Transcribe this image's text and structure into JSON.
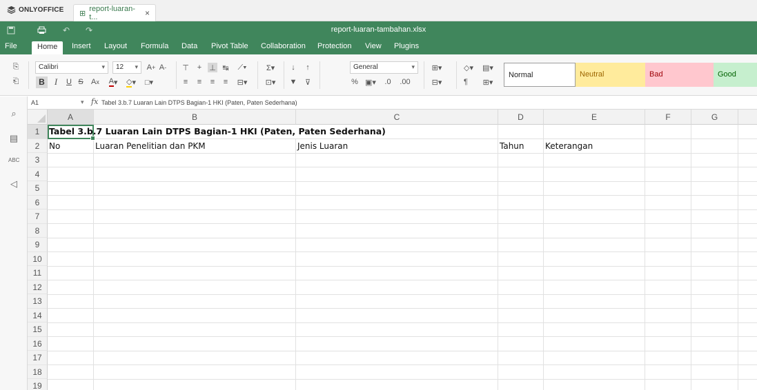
{
  "brand": {
    "name": "ONLYOFFICE"
  },
  "tab": {
    "title": "report-luaran-t...",
    "close": "×"
  },
  "window": {
    "filename": "report-luaran-tambahan.xlsx"
  },
  "menu": [
    "File",
    "Home",
    "Insert",
    "Layout",
    "Formula",
    "Data",
    "Pivot Table",
    "Collaboration",
    "Protection",
    "View",
    "Plugins"
  ],
  "active_menu": "Home",
  "toolbar": {
    "font_name": "Calibri",
    "font_size": "12",
    "number_format": "General",
    "bold": "B",
    "italic": "I",
    "underline": "U",
    "strike": "S",
    "percent": "%",
    "styles": [
      "Normal",
      "Neutral",
      "Bad",
      "Good"
    ]
  },
  "styles_colors": {
    "normal_bg": "#ffffff",
    "neutral_bg": "#ffeb9c",
    "neutral_fg": "#9c6500",
    "bad_bg": "#ffc7ce",
    "bad_fg": "#9c0006",
    "good_bg": "#c6efce",
    "good_fg": "#006100"
  },
  "formula_bar": {
    "cell_ref": "A1",
    "fx": "fx",
    "content": "Tabel 3.b.7 Luaran Lain DTPS Bagian-1 HKI (Paten, Paten Sederhana)"
  },
  "grid": {
    "columns": [
      "A",
      "B",
      "C",
      "D",
      "E",
      "F",
      "G"
    ],
    "rows": [
      "1",
      "2",
      "3",
      "4",
      "5",
      "6",
      "7",
      "8",
      "9",
      "10",
      "11",
      "12",
      "13",
      "14",
      "15",
      "16",
      "17",
      "18",
      "19"
    ],
    "cells": {
      "A1": "Tabel 3.b.7 Luaran Lain DTPS Bagian-1 HKI (Paten, Paten Sederhana)",
      "A2": "No",
      "B2": "Luaran Penelitian dan PKM",
      "C2": "Jenis Luaran",
      "D2": "Tahun",
      "E2": "Keterangan"
    }
  },
  "colors": {
    "accent": "#40865c"
  }
}
